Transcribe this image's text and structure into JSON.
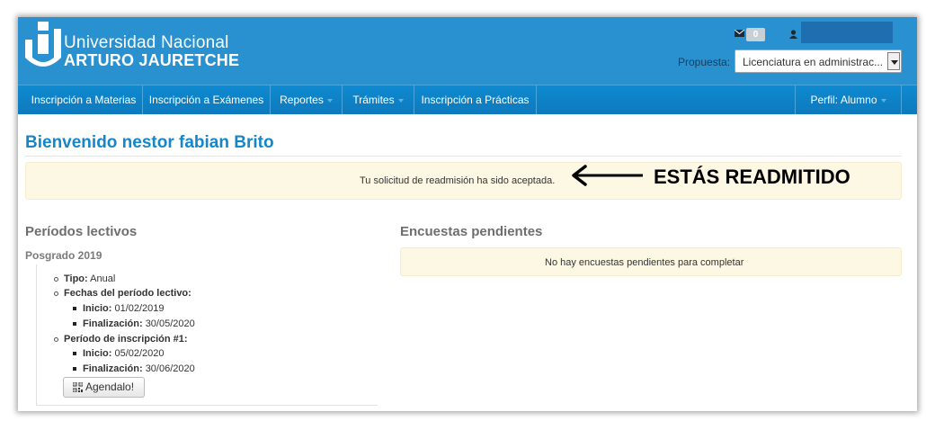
{
  "header": {
    "university_line1": "Universidad Nacional",
    "university_line2": "ARTURO JAURETCHE",
    "mail_count": "0",
    "propuesta_label": "Propuesta:",
    "propuesta_value": "Licenciatura en administrac...",
    "icons": [
      "university-logo",
      "mail-icon",
      "user-icon",
      "chevron-down-icon"
    ]
  },
  "nav": {
    "items": [
      {
        "label": "Inscripción a Materias",
        "dropdown": false
      },
      {
        "label": "Inscripción a Exámenes",
        "dropdown": false
      },
      {
        "label": "Reportes",
        "dropdown": true
      },
      {
        "label": "Trámites",
        "dropdown": true
      },
      {
        "label": "Inscripción a Prácticas",
        "dropdown": false
      }
    ],
    "profile_label": "Perfil: Alumno"
  },
  "main": {
    "welcome": "Bienvenido nestor fabian Brito",
    "alert_message": "Tu solicitud de readmisión ha sido aceptada.",
    "annotation": "ESTÁS READMITIDO"
  },
  "periodos": {
    "title": "Períodos lectivos",
    "subtitle": "Posgrado 2019",
    "tipo_label": "Tipo:",
    "tipo_value": "Anual",
    "fechas_label": "Fechas del período lectivo:",
    "inicio_label": "Inicio:",
    "inicio_value": "01/02/2019",
    "finalizacion_label": "Finalización:",
    "finalizacion_value": "30/05/2020",
    "inscripcion_label": "Período de inscripción #1:",
    "insc_inicio_label": "Inicio:",
    "insc_inicio_value": "05/02/2020",
    "insc_finalizacion_label": "Finalización:",
    "insc_finalizacion_value": "30/06/2020",
    "agendalo_label": "Agendalo!"
  },
  "encuestas": {
    "title": "Encuestas pendientes",
    "message": "No hay encuestas pendientes para completar"
  },
  "colors": {
    "header_bg": "#2991cf",
    "nav_bg": "#0d79bd",
    "title_blue": "#1587c9",
    "alert_bg": "#fcf8e3"
  }
}
